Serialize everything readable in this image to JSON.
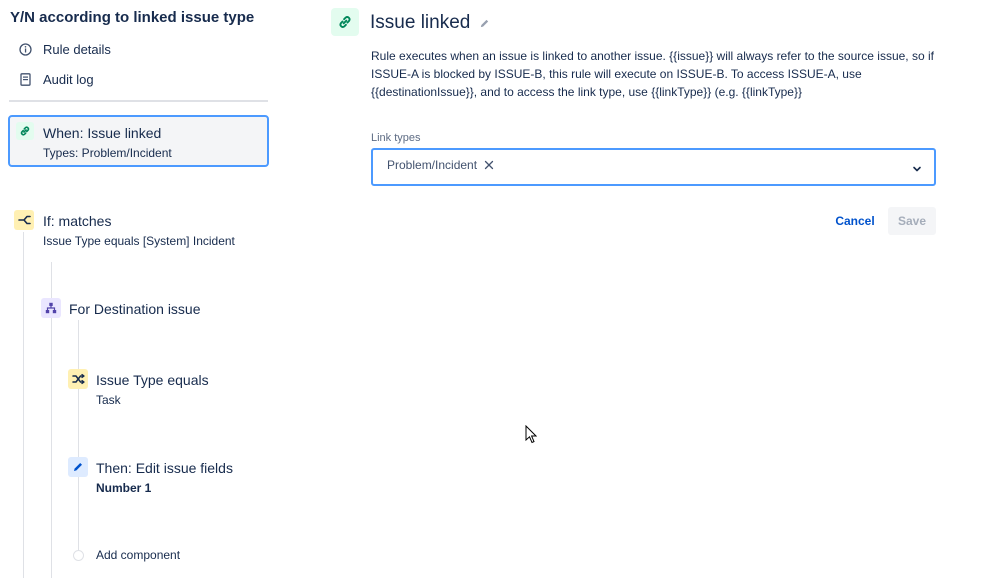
{
  "rule": {
    "title": "Y/N according to linked issue type"
  },
  "sidebar": {
    "links": [
      {
        "label": "Rule details",
        "icon": "info-icon"
      },
      {
        "label": "Audit log",
        "icon": "document-icon"
      }
    ],
    "steps": {
      "trigger": {
        "title": "When: Issue linked",
        "subtitle": "Types: Problem/Incident",
        "icon": "link-icon"
      },
      "condition": {
        "title": "If: matches",
        "subtitle": "Issue Type equals [System] Incident",
        "icon": "branch-condition-icon"
      },
      "branch": {
        "title": "For Destination issue",
        "icon": "branch-hierarchy-icon"
      },
      "subcondition": {
        "title": "Issue Type equals",
        "subtitle": "Task",
        "icon": "shuffle-icon"
      },
      "action": {
        "title": "Then: Edit issue fields",
        "subtitle": "Number 1",
        "icon": "pencil-icon"
      },
      "add_component": {
        "label": "Add component"
      }
    }
  },
  "panel": {
    "title": "Issue linked",
    "description": "Rule executes when an issue is linked to another issue. {{issue}} will always refer to the source issue, so if ISSUE-A is blocked by ISSUE-B, this rule will execute on ISSUE-B. To access ISSUE-A, use {{destinationIssue}}, and to access the link type, use {{linkType}} (e.g. {{linkType}}",
    "field_label": "Link types",
    "selected_tag": "Problem/Incident",
    "cancel_label": "Cancel",
    "save_label": "Save"
  },
  "colors": {
    "accent": "#4c9aff",
    "link": "#0052cc",
    "text": "#172b4d",
    "trigger_icon_bg": "#e3fcef",
    "condition_icon_bg": "#fff0b3",
    "branch_icon_bg": "#eae6ff",
    "action_icon_bg": "#deebff"
  }
}
